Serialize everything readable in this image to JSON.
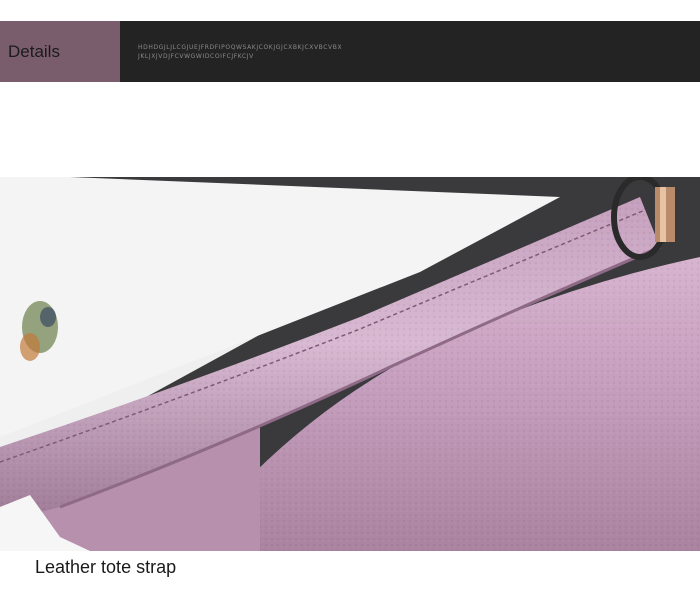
{
  "header": {
    "title": "Details",
    "code_line_1": "HDHDGJLJLCGJUEJFRDFIPOQWSAKJCOKJGJCXBKJCXVBCVBX",
    "code_line_2": "JKLJXJVDJFCVWGWIDCOIFCJFKCJV"
  },
  "photo": {
    "subject": "purple leather tote bag strap close-up",
    "colors": {
      "leather": "#c7a1bf",
      "leather_shadow": "#8e6a86",
      "background_dark": "#3a3a3c",
      "background_light": "#f2f2f2"
    }
  },
  "caption": "Leather tote strap"
}
